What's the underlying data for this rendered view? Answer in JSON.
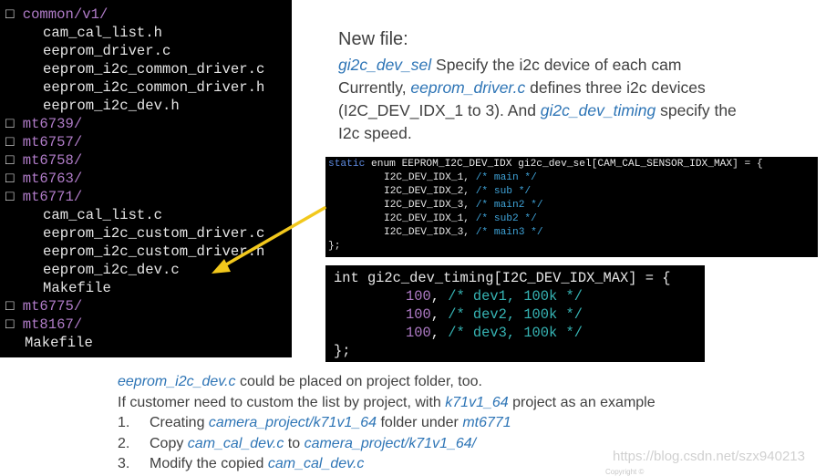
{
  "tree": {
    "box_glyph": "□",
    "items": [
      {
        "kind": "dir",
        "name": "common/v1/"
      },
      {
        "kind": "file",
        "name": "cam_cal_list.h"
      },
      {
        "kind": "file",
        "name": "eeprom_driver.c"
      },
      {
        "kind": "file",
        "name": "eeprom_i2c_common_driver.c"
      },
      {
        "kind": "file",
        "name": "eeprom_i2c_common_driver.h"
      },
      {
        "kind": "file",
        "name": "eeprom_i2c_dev.h"
      },
      {
        "kind": "dir",
        "name": "mt6739/"
      },
      {
        "kind": "dir",
        "name": "mt6757/"
      },
      {
        "kind": "dir",
        "name": "mt6758/"
      },
      {
        "kind": "dir",
        "name": "mt6763/"
      },
      {
        "kind": "dir",
        "name": "mt6771/"
      },
      {
        "kind": "file",
        "name": "cam_cal_list.c"
      },
      {
        "kind": "file",
        "name": "eeprom_i2c_custom_driver.c"
      },
      {
        "kind": "file",
        "name": "eeprom_i2c_custom_driver.h"
      },
      {
        "kind": "file",
        "name": "eeprom_i2c_dev.c"
      },
      {
        "kind": "file",
        "name": "Makefile"
      },
      {
        "kind": "dir",
        "name": "mt6775/"
      },
      {
        "kind": "dir",
        "name": "mt8167/"
      },
      {
        "kind": "top",
        "name": "Makefile"
      }
    ]
  },
  "desc": {
    "heading": "New file:",
    "p1": {
      "a": "gi2c_dev_sel",
      "b": " Specify the i2c device of each cam"
    },
    "p2": {
      "a": "Currently, ",
      "b": "eeprom_driver.c",
      "c": " defines three i2c devices"
    },
    "p3": {
      "a": "(I2C_DEV_IDX_1 to 3). And ",
      "b": "gi2c_dev_timing",
      "c": " specify the"
    },
    "p4": "I2c speed."
  },
  "code1": {
    "line0": {
      "kw": "static",
      "rest": " enum EEPROM_I2C_DEV_IDX gi2c_dev_sel[CAM_CAL_SENSOR_IDX_MAX] = {"
    },
    "entries": [
      {
        "idx": "I2C_DEV_IDX_1,",
        "comment": "/* main */"
      },
      {
        "idx": "I2C_DEV_IDX_2,",
        "comment": "/* sub */"
      },
      {
        "idx": "I2C_DEV_IDX_3,",
        "comment": "/* main2 */"
      },
      {
        "idx": "I2C_DEV_IDX_1,",
        "comment": "/* sub2 */"
      },
      {
        "idx": "I2C_DEV_IDX_3,",
        "comment": "/* main3 */"
      }
    ],
    "close": "};"
  },
  "code2": {
    "line0": "int gi2c_dev_timing[I2C_DEV_IDX_MAX] = {",
    "entries": [
      {
        "num": "100",
        "sep": ", ",
        "comment": "/* dev1, 100k */"
      },
      {
        "num": "100",
        "sep": ", ",
        "comment": "/* dev2, 100k */"
      },
      {
        "num": "100",
        "sep": ", ",
        "comment": "/* dev3, 100k */"
      }
    ],
    "close": "};"
  },
  "bottom": {
    "l1": {
      "a": "eeprom_i2c_dev.c",
      "b": " could be placed on project folder, too."
    },
    "l2": {
      "a": "If customer need to custom the list by project, with ",
      "b": "k71v1_64",
      "c": " project as an example"
    },
    "steps": [
      {
        "n": "1.",
        "a": "Creating ",
        "b": "camera_project/k71v1_64",
        "c": " folder under ",
        "d": "mt6771",
        "e": ""
      },
      {
        "n": "2.",
        "a": "Copy ",
        "b": "cam_cal_dev.c",
        "c": " to ",
        "d": "camera_project/k71v1_64/",
        "e": ""
      },
      {
        "n": "3.",
        "a": "Modify the copied ",
        "b": "cam_cal_dev.c",
        "c": "",
        "d": "",
        "e": ""
      }
    ]
  },
  "watermark": "https://blog.csdn.net/szx940213",
  "copyright": "Copyright ©",
  "colors": {
    "highlight": "#2e75b6",
    "arrow": "#f2c81c",
    "dir": "#b07cc8",
    "comment": "#36b4b4"
  }
}
